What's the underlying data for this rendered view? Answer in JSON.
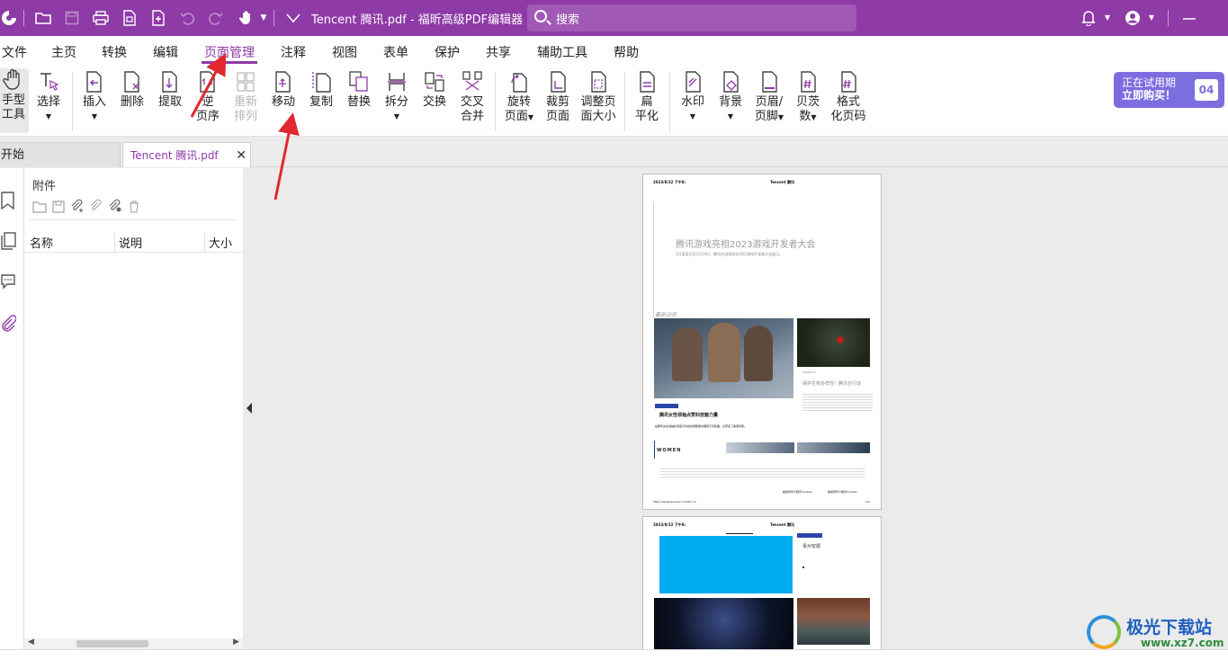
{
  "titlebar": {
    "doc_title": "Tencent 腾讯.pdf - 福昕高级PDF编辑器",
    "search_placeholder": "搜索"
  },
  "menu": [
    "文件",
    "主页",
    "转换",
    "编辑",
    "页面管理",
    "注释",
    "视图",
    "表单",
    "保护",
    "共享",
    "辅助工具",
    "帮助"
  ],
  "active_menu": "页面管理",
  "ribbon": {
    "hand": [
      "手型",
      "工具"
    ],
    "select": "选择",
    "insert": "插入",
    "delete": "删除",
    "extract": "提取",
    "reverse": [
      "逆",
      "页序"
    ],
    "reorder": [
      "重新",
      "排列"
    ],
    "move": "移动",
    "copy": "复制",
    "replace": "替换",
    "split": "拆分",
    "swap": "交换",
    "crossmerge": [
      "交叉",
      "合并"
    ],
    "rotate": [
      "旋转",
      "页面"
    ],
    "crop": [
      "裁剪",
      "页面"
    ],
    "resize": [
      "调整页",
      "面大小"
    ],
    "flatten": [
      "扁",
      "平化"
    ],
    "watermark": "水印",
    "background": "背景",
    "headerfooter": [
      "页眉/",
      "页脚"
    ],
    "bates": [
      "贝茨",
      "数"
    ],
    "pagenum": [
      "格式",
      "化页码"
    ]
  },
  "trial": {
    "line1": "正在试用期",
    "line2": "立即购买！",
    "days": "04"
  },
  "tabs": {
    "start": "开始",
    "doc": "Tencent 腾讯.pdf",
    "close": "✕"
  },
  "panel": {
    "title": "附件",
    "col_name": "名称",
    "col_desc": "说明",
    "col_size": "大小"
  },
  "page1": {
    "header_left": "2023/8/22 下午8:",
    "header_center": "Tencent 腾讯",
    "heading": "腾讯游戏亮相2023游戏开发者大会",
    "sub": "3月某某日至3月24日，腾讯先进游戏在GDC游戏开发者大会展示。",
    "section": "最新动态",
    "card_label": "PROJECTS",
    "card_title": "保护生物多样性！腾讯在行动",
    "women": "WOMEN",
    "bold_title": "腾讯女性领袖点赞科技魅力量",
    "bold_line": "是那年女性领袖在家庭与科技领域能量中展现不同的面，也带来了各项积累。",
    "footer_url": "https://www.tencent.com/zh-cn/",
    "footer_num": "1/2",
    "footer_mid": "版权所有©腾讯Cookies",
    "footer_right": "版权所有©腾讯Cookies"
  },
  "page2": {
    "header_left": "2023/8/22 下午8:",
    "header_center": "Tencent 腾讯",
    "card_title": "贵州安顺"
  },
  "colors": {
    "brand": "#8e3aa7",
    "trial": "#7c6de0",
    "annotation": "#e0282e",
    "blue_block": "#00adef"
  },
  "watermark": {
    "name": "极光下载站",
    "url": "www.xz7.com"
  }
}
